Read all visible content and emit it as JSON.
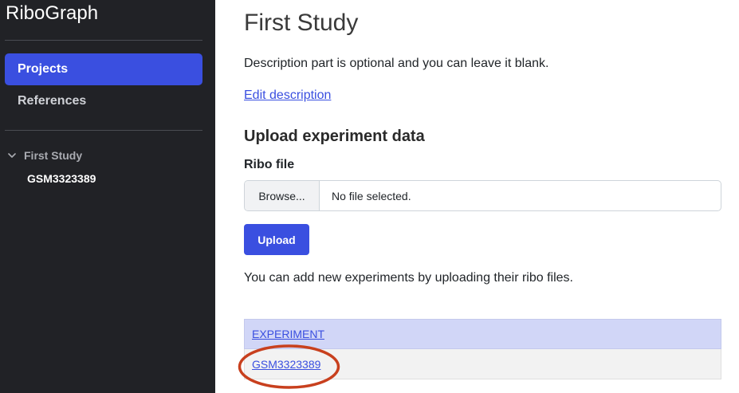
{
  "sidebar": {
    "brand": "RiboGraph",
    "nav": {
      "projects": "Projects",
      "references": "References"
    },
    "tree": {
      "study": "First Study",
      "experiment": "GSM3323389"
    }
  },
  "main": {
    "title": "First Study",
    "description": "Description part is optional and you can leave it blank.",
    "edit_description": "Edit description",
    "upload_heading": "Upload experiment data",
    "ribo_file_label": "Ribo file",
    "file_input": {
      "browse_label": "Browse...",
      "status": "No file selected."
    },
    "upload_button": "Upload",
    "hint": "You can add new experiments by uploading their ribo files.",
    "table": {
      "header": "EXPERIMENT",
      "rows": [
        "GSM3323389"
      ]
    }
  },
  "colors": {
    "sidebar_bg": "#212226",
    "accent": "#3a4fe0",
    "table_header_bg": "#d1d6f7",
    "annotation": "#c8401e"
  },
  "icons": {
    "tree_toggle": "chevron-down-icon"
  }
}
